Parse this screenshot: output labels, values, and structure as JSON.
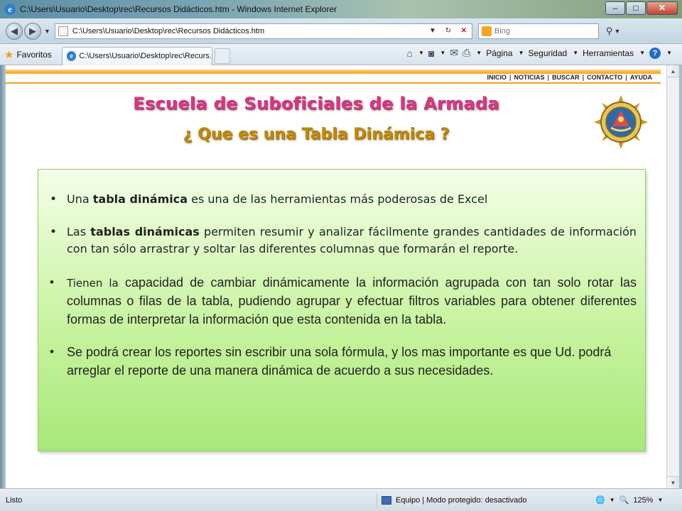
{
  "window": {
    "title": "C:\\Users\\Usuario\\Desktop\\rec\\Recursos Didácticos.htm - Windows Internet Explorer",
    "min": "–",
    "max": "□",
    "close": "✕"
  },
  "address": {
    "url": "C:\\Users\\Usuario\\Desktop\\rec\\Recursos Didácticos.htm",
    "search_placeholder": "Bing"
  },
  "favorites": {
    "label": "Favoritos",
    "tab_label": "C:\\Users\\Usuario\\Desktop\\rec\\Recurs..."
  },
  "commandbar": {
    "page": "Página",
    "security": "Seguridad",
    "tools": "Herramientas"
  },
  "topnav": [
    "INICIO",
    "NOTICIAS",
    "BUSCAR",
    "CONTACTO",
    "AYUDA"
  ],
  "page": {
    "title": "Escuela de Suboficiales de la Armada",
    "subtitle": "¿ Que es una Tabla Dinámica ?",
    "b1_pre": "Una ",
    "b1_bold": "tabla dinámica",
    "b1_post": " es una de las herramientas más poderosas de Excel",
    "b2_pre": "Las ",
    "b2_bold": "tablas dinámicas",
    "b2_post": " permiten resumir y analizar fácilmente grandes cantidades de información con tan sólo arrastrar y soltar las diferentes columnas que formarán el reporte.",
    "b3_lead": "Tienen la",
    "b3_rest": " capacidad de cambiar dinámicamente la información agrupada con tan solo rotar las columnas o filas de la tabla, pudiendo agrupar y efectuar filtros variables para obtener diferentes formas de interpretar la información que esta contenida en la tabla.",
    "b4": "Se podrá crear los reportes sin escribir una sola fórmula, y los mas importante es que Ud. podrá  arreglar el reporte de una manera dinámica de acuerdo a sus necesidades."
  },
  "status": {
    "text": "Listo",
    "zone": "Equipo | Modo protegido: desactivado",
    "zoom": "125%"
  },
  "colors": {
    "title": "#d43a7e",
    "subtitle": "#c08a0a",
    "accent_bar": "#f6a21a",
    "box_top": "#f4ffe8",
    "box_bottom": "#a8e87a"
  }
}
